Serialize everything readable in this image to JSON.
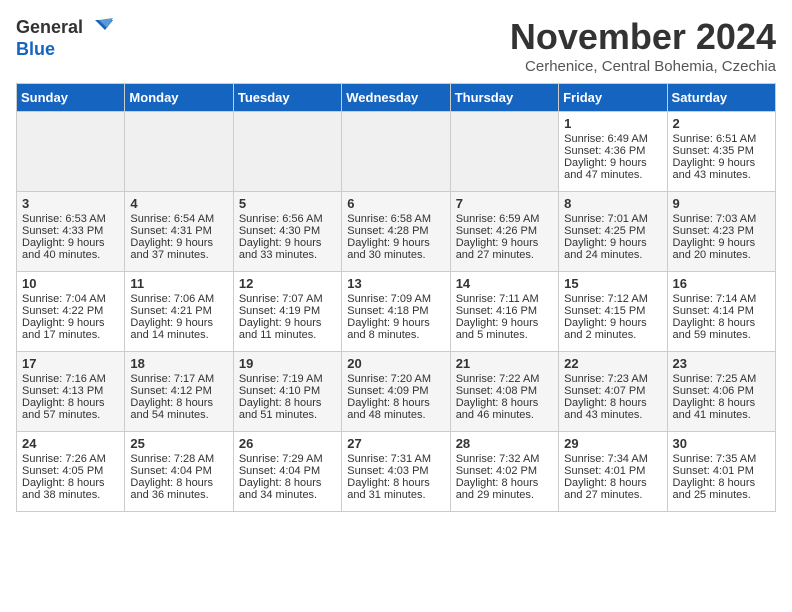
{
  "header": {
    "logo_line1": "General",
    "logo_line2": "Blue",
    "month_title": "November 2024",
    "location": "Cerhenice, Central Bohemia, Czechia"
  },
  "weekdays": [
    "Sunday",
    "Monday",
    "Tuesday",
    "Wednesday",
    "Thursday",
    "Friday",
    "Saturday"
  ],
  "weeks": [
    [
      {
        "day": "",
        "info": ""
      },
      {
        "day": "",
        "info": ""
      },
      {
        "day": "",
        "info": ""
      },
      {
        "day": "",
        "info": ""
      },
      {
        "day": "",
        "info": ""
      },
      {
        "day": "1",
        "info": "Sunrise: 6:49 AM\nSunset: 4:36 PM\nDaylight: 9 hours\nand 47 minutes."
      },
      {
        "day": "2",
        "info": "Sunrise: 6:51 AM\nSunset: 4:35 PM\nDaylight: 9 hours\nand 43 minutes."
      }
    ],
    [
      {
        "day": "3",
        "info": "Sunrise: 6:53 AM\nSunset: 4:33 PM\nDaylight: 9 hours\nand 40 minutes."
      },
      {
        "day": "4",
        "info": "Sunrise: 6:54 AM\nSunset: 4:31 PM\nDaylight: 9 hours\nand 37 minutes."
      },
      {
        "day": "5",
        "info": "Sunrise: 6:56 AM\nSunset: 4:30 PM\nDaylight: 9 hours\nand 33 minutes."
      },
      {
        "day": "6",
        "info": "Sunrise: 6:58 AM\nSunset: 4:28 PM\nDaylight: 9 hours\nand 30 minutes."
      },
      {
        "day": "7",
        "info": "Sunrise: 6:59 AM\nSunset: 4:26 PM\nDaylight: 9 hours\nand 27 minutes."
      },
      {
        "day": "8",
        "info": "Sunrise: 7:01 AM\nSunset: 4:25 PM\nDaylight: 9 hours\nand 24 minutes."
      },
      {
        "day": "9",
        "info": "Sunrise: 7:03 AM\nSunset: 4:23 PM\nDaylight: 9 hours\nand 20 minutes."
      }
    ],
    [
      {
        "day": "10",
        "info": "Sunrise: 7:04 AM\nSunset: 4:22 PM\nDaylight: 9 hours\nand 17 minutes."
      },
      {
        "day": "11",
        "info": "Sunrise: 7:06 AM\nSunset: 4:21 PM\nDaylight: 9 hours\nand 14 minutes."
      },
      {
        "day": "12",
        "info": "Sunrise: 7:07 AM\nSunset: 4:19 PM\nDaylight: 9 hours\nand 11 minutes."
      },
      {
        "day": "13",
        "info": "Sunrise: 7:09 AM\nSunset: 4:18 PM\nDaylight: 9 hours\nand 8 minutes."
      },
      {
        "day": "14",
        "info": "Sunrise: 7:11 AM\nSunset: 4:16 PM\nDaylight: 9 hours\nand 5 minutes."
      },
      {
        "day": "15",
        "info": "Sunrise: 7:12 AM\nSunset: 4:15 PM\nDaylight: 9 hours\nand 2 minutes."
      },
      {
        "day": "16",
        "info": "Sunrise: 7:14 AM\nSunset: 4:14 PM\nDaylight: 8 hours\nand 59 minutes."
      }
    ],
    [
      {
        "day": "17",
        "info": "Sunrise: 7:16 AM\nSunset: 4:13 PM\nDaylight: 8 hours\nand 57 minutes."
      },
      {
        "day": "18",
        "info": "Sunrise: 7:17 AM\nSunset: 4:12 PM\nDaylight: 8 hours\nand 54 minutes."
      },
      {
        "day": "19",
        "info": "Sunrise: 7:19 AM\nSunset: 4:10 PM\nDaylight: 8 hours\nand 51 minutes."
      },
      {
        "day": "20",
        "info": "Sunrise: 7:20 AM\nSunset: 4:09 PM\nDaylight: 8 hours\nand 48 minutes."
      },
      {
        "day": "21",
        "info": "Sunrise: 7:22 AM\nSunset: 4:08 PM\nDaylight: 8 hours\nand 46 minutes."
      },
      {
        "day": "22",
        "info": "Sunrise: 7:23 AM\nSunset: 4:07 PM\nDaylight: 8 hours\nand 43 minutes."
      },
      {
        "day": "23",
        "info": "Sunrise: 7:25 AM\nSunset: 4:06 PM\nDaylight: 8 hours\nand 41 minutes."
      }
    ],
    [
      {
        "day": "24",
        "info": "Sunrise: 7:26 AM\nSunset: 4:05 PM\nDaylight: 8 hours\nand 38 minutes."
      },
      {
        "day": "25",
        "info": "Sunrise: 7:28 AM\nSunset: 4:04 PM\nDaylight: 8 hours\nand 36 minutes."
      },
      {
        "day": "26",
        "info": "Sunrise: 7:29 AM\nSunset: 4:04 PM\nDaylight: 8 hours\nand 34 minutes."
      },
      {
        "day": "27",
        "info": "Sunrise: 7:31 AM\nSunset: 4:03 PM\nDaylight: 8 hours\nand 31 minutes."
      },
      {
        "day": "28",
        "info": "Sunrise: 7:32 AM\nSunset: 4:02 PM\nDaylight: 8 hours\nand 29 minutes."
      },
      {
        "day": "29",
        "info": "Sunrise: 7:34 AM\nSunset: 4:01 PM\nDaylight: 8 hours\nand 27 minutes."
      },
      {
        "day": "30",
        "info": "Sunrise: 7:35 AM\nSunset: 4:01 PM\nDaylight: 8 hours\nand 25 minutes."
      }
    ]
  ]
}
